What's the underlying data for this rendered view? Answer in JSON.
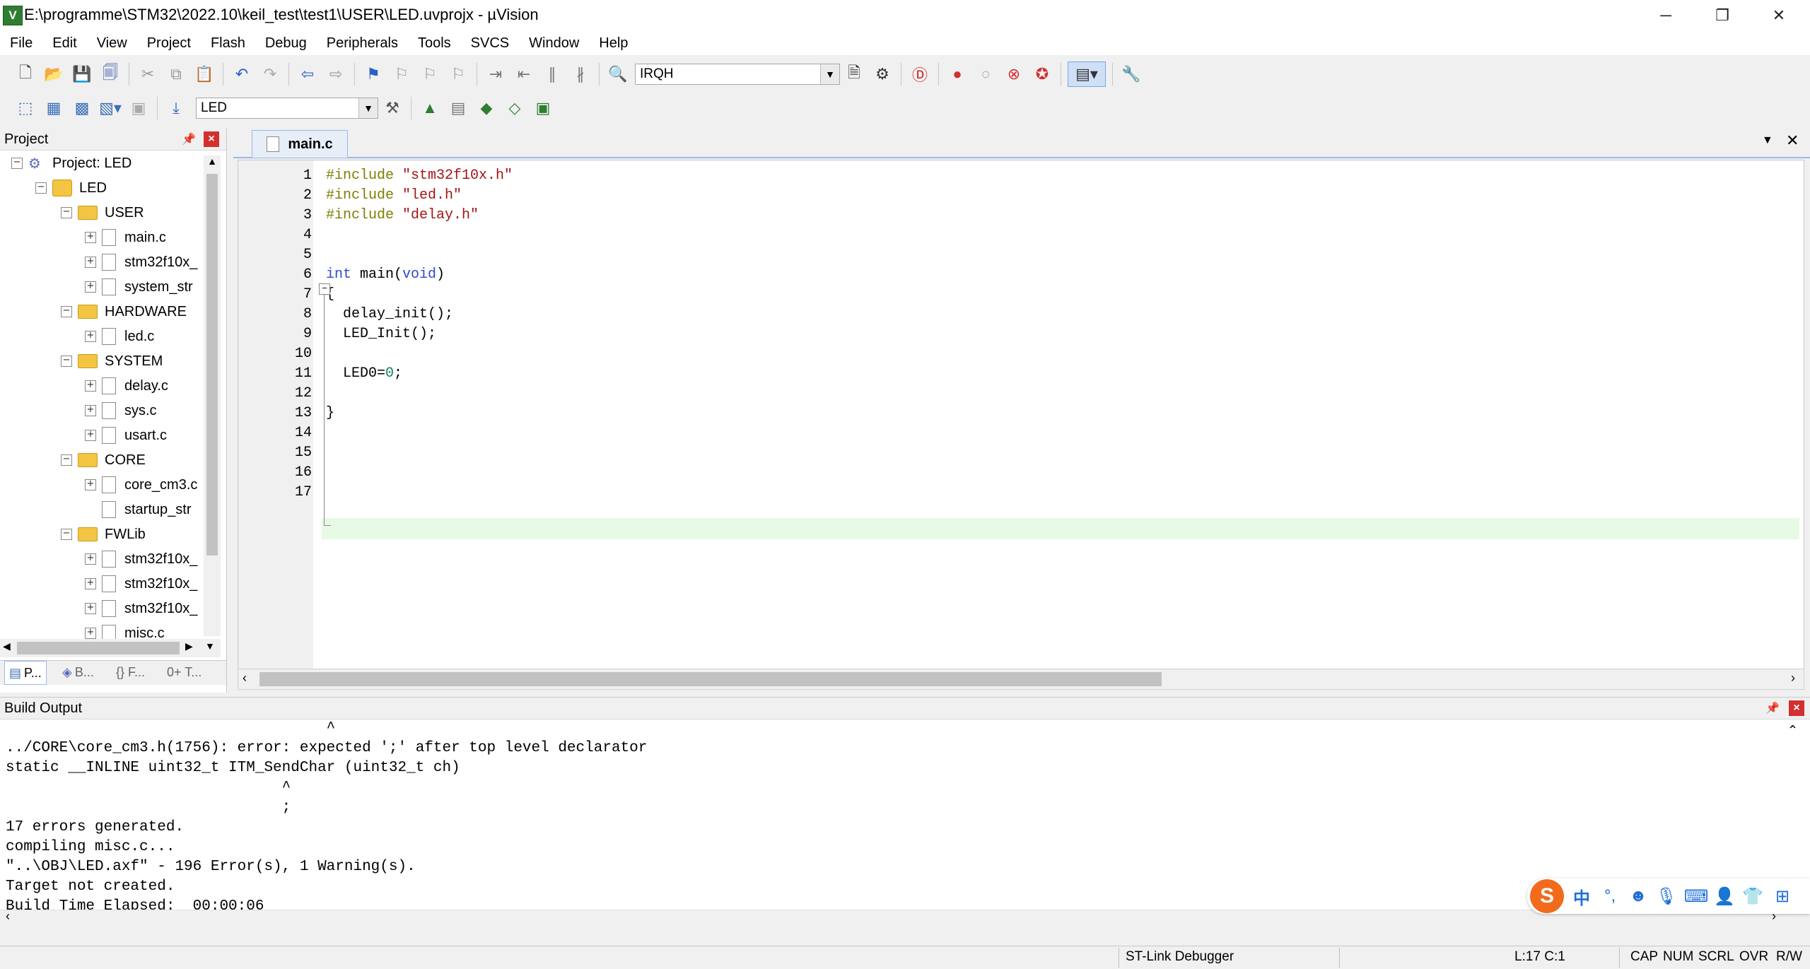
{
  "window": {
    "title": "E:\\programme\\STM32\\2022.10\\keil_test\\test1\\USER\\LED.uvprojx - µVision",
    "app_icon_letter": "V",
    "minimize": "─",
    "restore": "❐",
    "close": "✕"
  },
  "menu": [
    "File",
    "Edit",
    "View",
    "Project",
    "Flash",
    "Debug",
    "Peripherals",
    "Tools",
    "SVCS",
    "Window",
    "Help"
  ],
  "toolbar1": {
    "find_combo_value": "IRQH"
  },
  "toolbar2": {
    "target_combo_value": "LED"
  },
  "project_panel": {
    "title": "Project",
    "root": "Project: LED",
    "target": "LED",
    "groups": [
      {
        "name": "USER",
        "files": [
          "main.c",
          "stm32f10x_",
          "system_str"
        ]
      },
      {
        "name": "HARDWARE",
        "files": [
          "led.c"
        ]
      },
      {
        "name": "SYSTEM",
        "files": [
          "delay.c",
          "sys.c",
          "usart.c"
        ]
      },
      {
        "name": "CORE",
        "files": [
          "core_cm3.c",
          "startup_str"
        ]
      },
      {
        "name": "FWLib",
        "files": [
          "stm32f10x_",
          "stm32f10x_",
          "stm32f10x_",
          "misc.c"
        ]
      }
    ],
    "tabs": [
      "P...",
      "B...",
      "{} F...",
      "0+ T..."
    ]
  },
  "editor": {
    "tab": "main.c",
    "lines": [
      {
        "n": "1",
        "tokens": [
          [
            "pp",
            "#include "
          ],
          [
            "str",
            "\"stm32f10x.h\""
          ]
        ]
      },
      {
        "n": "2",
        "tokens": [
          [
            "pp",
            "#include "
          ],
          [
            "str",
            "\"led.h\""
          ]
        ]
      },
      {
        "n": "3",
        "tokens": [
          [
            "pp",
            "#include "
          ],
          [
            "str",
            "\"delay.h\""
          ]
        ]
      },
      {
        "n": "4",
        "tokens": []
      },
      {
        "n": "5",
        "tokens": []
      },
      {
        "n": "6",
        "tokens": [
          [
            "kw",
            "int"
          ],
          [
            "txt",
            " main("
          ],
          [
            "kw",
            "void"
          ],
          [
            "txt",
            ")"
          ]
        ]
      },
      {
        "n": "7",
        "tokens": [
          [
            "txt",
            "{"
          ]
        ]
      },
      {
        "n": "8",
        "tokens": [
          [
            "txt",
            "  delay_init();"
          ]
        ]
      },
      {
        "n": "9",
        "tokens": [
          [
            "txt",
            "  LED_Init();"
          ]
        ]
      },
      {
        "n": "10",
        "tokens": []
      },
      {
        "n": "11",
        "tokens": [
          [
            "txt",
            "  LED0="
          ],
          [
            "num",
            "0"
          ],
          [
            "txt",
            ";"
          ]
        ]
      },
      {
        "n": "12",
        "tokens": []
      },
      {
        "n": "13",
        "tokens": [
          [
            "txt",
            "}"
          ]
        ]
      },
      {
        "n": "14",
        "tokens": []
      },
      {
        "n": "15",
        "tokens": []
      },
      {
        "n": "16",
        "tokens": []
      },
      {
        "n": "17",
        "tokens": []
      }
    ],
    "current_line": "17"
  },
  "build_output": {
    "title": "Build Output",
    "lines": [
      "                                    ^",
      "../CORE\\core_cm3.h(1756): error: expected ';' after top level declarator",
      "static __INLINE uint32_t ITM_SendChar (uint32_t ch)",
      "                               ^",
      "                               ;",
      "17 errors generated.",
      "compiling misc.c...",
      "\"..\\OBJ\\LED.axf\" - 196 Error(s), 1 Warning(s).",
      "Target not created.",
      "Build Time Elapsed:  00:00:06"
    ]
  },
  "status": {
    "debugger": "ST-Link Debugger",
    "cursor": "L:17 C:1",
    "cap": "CAP",
    "num": "NUM",
    "scrl": "SCRL",
    "ovr": "OVR",
    "rw": "R/W"
  },
  "ime": {
    "logo": "S",
    "mode": "中"
  }
}
